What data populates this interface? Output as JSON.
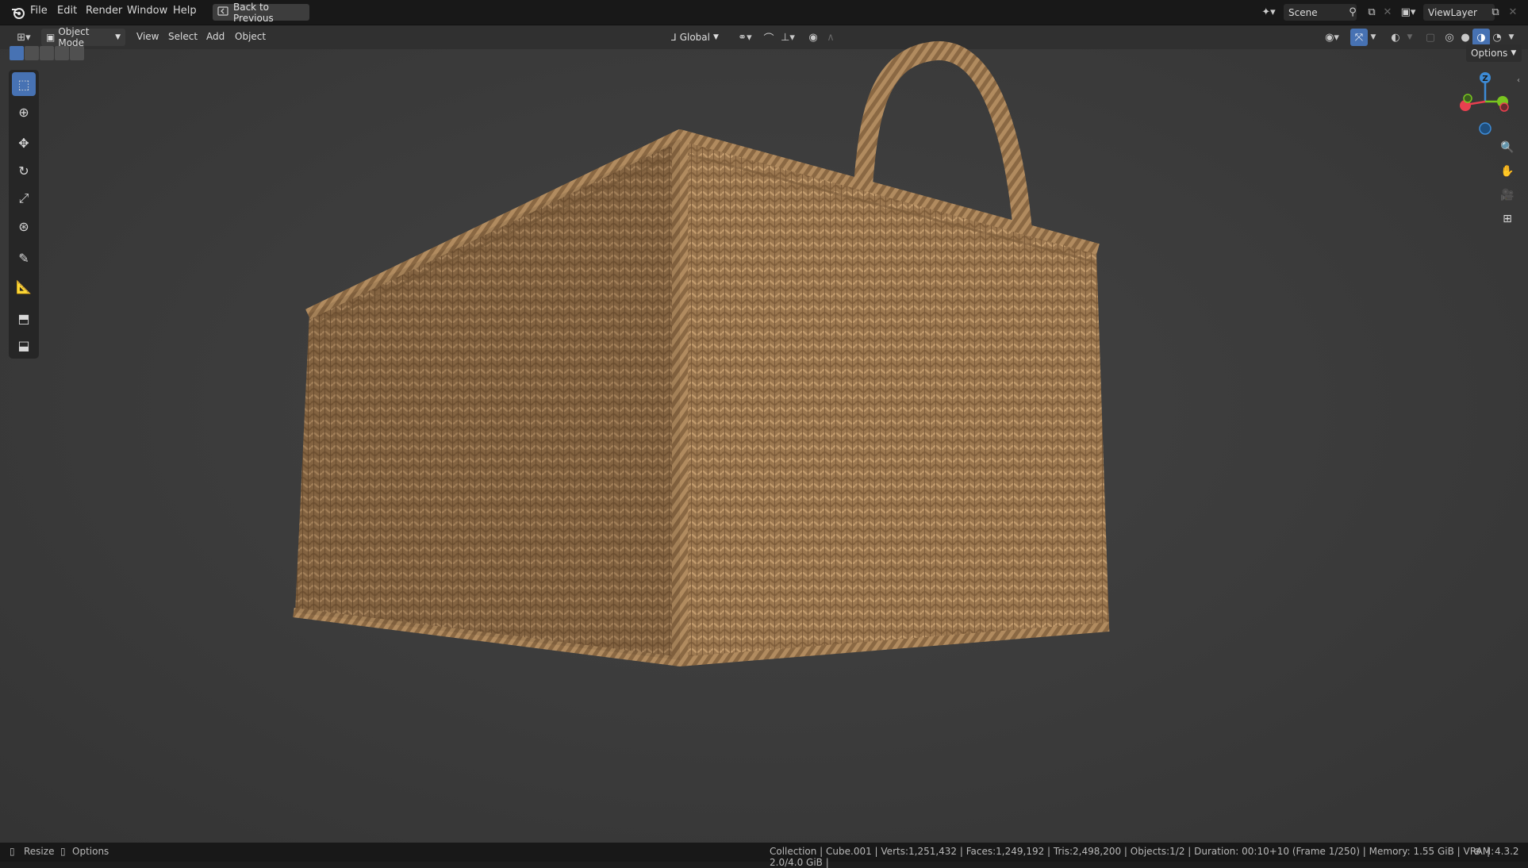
{
  "menus": [
    "File",
    "Edit",
    "Render",
    "Window",
    "Help"
  ],
  "back_button": "Back to Previous",
  "scene": {
    "name": "Scene"
  },
  "view_layer": {
    "name": "ViewLayer"
  },
  "header": {
    "mode": "Object Mode",
    "menus": [
      "View",
      "Select",
      "Add",
      "Object"
    ],
    "orientation": "Global",
    "options": "Options"
  },
  "gizmo": {
    "z_label": "Z"
  },
  "status": {
    "left": [
      "Resize",
      "Options"
    ],
    "info": "Collection | Cube.001 | Verts:1,251,432 | Faces:1,249,192 | Tris:2,498,200 | Objects:1/2 | Duration: 00:10+10 (Frame 1/250) | Memory: 1.55 GiB | VRAM: 2.0/4.0 GiB |",
    "version": "4.3.2"
  },
  "colors": {
    "accent": "#4772b3",
    "wicker": "#9a7650",
    "axis_x": "#e8404f",
    "axis_y": "#79c51f",
    "axis_z": "#3d8bd6"
  },
  "icons": {
    "blender": "blender-icon",
    "tools": [
      "select-box-icon",
      "cursor-icon",
      "move-icon",
      "rotate-icon",
      "scale-icon",
      "transform-icon",
      "annotate-icon",
      "measure-icon",
      "add-cube-icon",
      "extrude-icon"
    ],
    "nav": [
      "zoom-icon",
      "pan-hand-icon",
      "camera-view-icon",
      "grid-ortho-icon"
    ]
  }
}
